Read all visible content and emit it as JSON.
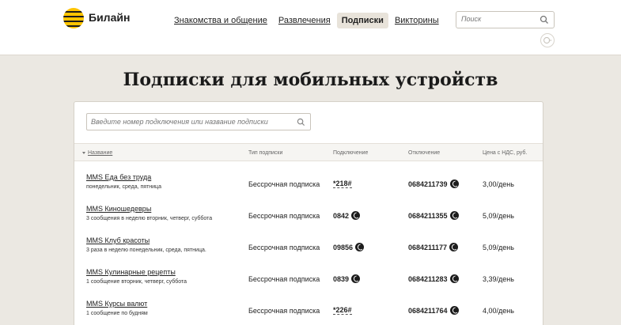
{
  "header": {
    "brand": "Билайн",
    "nav": [
      {
        "label": "Знакомства и общение",
        "active": false
      },
      {
        "label": "Развлечения",
        "active": false
      },
      {
        "label": "Подписки",
        "active": true
      },
      {
        "label": "Викторины",
        "active": false
      }
    ],
    "search": {
      "placeholder": "Поиск"
    }
  },
  "page_title": "Подписки для мобильных устройств",
  "filter": {
    "placeholder": "Введите номер подключения или название подписки"
  },
  "table": {
    "columns": [
      "Название",
      "Тип подписки",
      "Подключение",
      "Отключение",
      "Цена с НДС, руб."
    ],
    "rows": [
      {
        "name": "MMS Еда без труда",
        "desc": "понедельник, среда, пятница",
        "type": "Бессрочная подписка",
        "connect": "*218#",
        "connect_phone": false,
        "disconnect": "0684211739",
        "price": "3,00/день"
      },
      {
        "name": "MMS Киношедевры",
        "desc": "3 сообщения в неделю вторник, четверг, суббота",
        "type": "Бессрочная подписка",
        "connect": "0842",
        "connect_phone": true,
        "disconnect": "0684211355",
        "price": "5,09/день"
      },
      {
        "name": "MMS Клуб красоты",
        "desc": "3 раза в неделю понедельник, среда, пятница.",
        "type": "Бессрочная подписка",
        "connect": "09856",
        "connect_phone": true,
        "disconnect": "0684211177",
        "price": "5,09/день"
      },
      {
        "name": "MMS Кулинарные рецепты",
        "desc": "1 сообщение вторник, четверг, суббота",
        "type": "Бессрочная подписка",
        "connect": "0839",
        "connect_phone": true,
        "disconnect": "0684211283",
        "price": "3,39/день"
      },
      {
        "name": "MMS Курсы валют",
        "desc": "1 сообщение по будням",
        "type": "Бессрочная подписка",
        "connect": "*226#",
        "connect_phone": false,
        "disconnect": "0684211764",
        "price": "4,00/день"
      }
    ]
  }
}
